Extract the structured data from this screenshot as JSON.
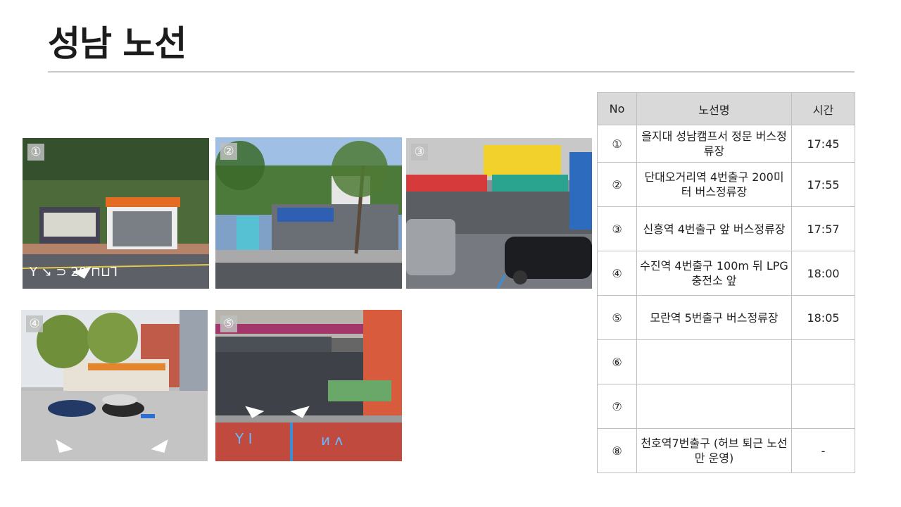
{
  "page": {
    "title": "성남 노선"
  },
  "photos": [
    {
      "badge": "①"
    },
    {
      "badge": "②"
    },
    {
      "badge": "③"
    },
    {
      "badge": "④"
    },
    {
      "badge": "⑤"
    }
  ],
  "table": {
    "headers": [
      "No",
      "노선명",
      "시간"
    ],
    "rows": [
      {
        "no": "①",
        "name": "을지대 성남캠프서 정문 버스정류장",
        "time": "17:45"
      },
      {
        "no": "②",
        "name": "단대오거리역 4번출구 200미터 버스정류장",
        "time": "17:55"
      },
      {
        "no": "③",
        "name": "신흥역 4번출구 앞 버스정류장",
        "time": "17:57"
      },
      {
        "no": "④",
        "name": "수진역 4번출구 100m 뒤 LPG충전소 앞",
        "time": "18:00"
      },
      {
        "no": "⑤",
        "name": "모란역 5번출구 버스정류장",
        "time": "18:05"
      },
      {
        "no": "⑥",
        "name": "",
        "time": ""
      },
      {
        "no": "⑦",
        "name": "",
        "time": ""
      },
      {
        "no": "⑧",
        "name": "천호역7번출구 (허브 퇴근 노선만 운영)",
        "time": "-"
      }
    ]
  }
}
